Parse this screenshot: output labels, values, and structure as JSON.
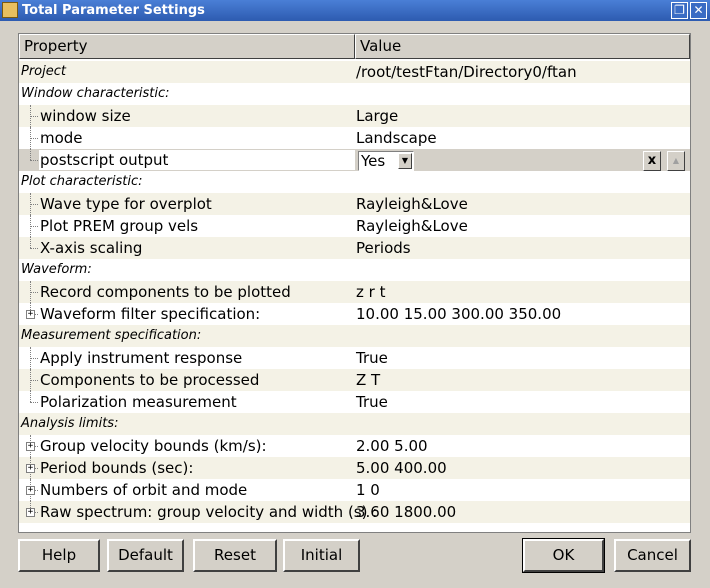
{
  "window": {
    "title": "Total Parameter Settings",
    "max_glyph": "❐",
    "close_glyph": "✕"
  },
  "table": {
    "headers": {
      "property": "Property",
      "value": "Value"
    },
    "rows": [
      {
        "label": "Project",
        "value": "/root/testFtan/Directory0/ftan",
        "kind": "cat"
      },
      {
        "label": "Window characteristic:",
        "value": "",
        "kind": "cat"
      },
      {
        "label": "window size",
        "value": "Large",
        "kind": "child"
      },
      {
        "label": "mode",
        "value": "Landscape",
        "kind": "child"
      },
      {
        "label": "postscript output",
        "value": "Yes",
        "kind": "editor"
      },
      {
        "label": "Plot characteristic:",
        "value": "",
        "kind": "cat"
      },
      {
        "label": "Wave type for overplot",
        "value": "Rayleigh&Love",
        "kind": "child"
      },
      {
        "label": "Plot PREM group vels",
        "value": "Rayleigh&Love",
        "kind": "child"
      },
      {
        "label": "X-axis scaling",
        "value": "Periods",
        "kind": "child"
      },
      {
        "label": "Waveform:",
        "value": "",
        "kind": "cat"
      },
      {
        "label": "Record components to be plotted",
        "value": "z r t",
        "kind": "child"
      },
      {
        "label": "Waveform filter specification:",
        "value": "10.00  15.00  300.00  350.00",
        "kind": "expand"
      },
      {
        "label": "Measurement specification:",
        "value": "",
        "kind": "cat"
      },
      {
        "label": "Apply instrument response",
        "value": "True",
        "kind": "child"
      },
      {
        "label": "Components to be processed",
        "value": "Z T",
        "kind": "child"
      },
      {
        "label": "Polarization measurement",
        "value": "True",
        "kind": "child"
      },
      {
        "label": "Analysis limits:",
        "value": "",
        "kind": "cat"
      },
      {
        "label": "Group velocity bounds (km/s):",
        "value": "2.00  5.00",
        "kind": "expand"
      },
      {
        "label": "Period bounds (sec):",
        "value": "5.00  400.00",
        "kind": "expand"
      },
      {
        "label": "Numbers of orbit and mode",
        "value": "1  0",
        "kind": "expand"
      },
      {
        "label": "Raw spectrum: group velocity and width (s) :",
        "value": "3.60  1800.00",
        "kind": "expand"
      }
    ],
    "editor": {
      "selected": "Yes",
      "clear_label": "x",
      "arrow_glyph": "▼",
      "up_glyph": "▲"
    }
  },
  "buttons": {
    "help": "Help",
    "default": "Default",
    "reset": "Reset",
    "initial": "Initial",
    "ok": "OK",
    "cancel": "Cancel"
  }
}
